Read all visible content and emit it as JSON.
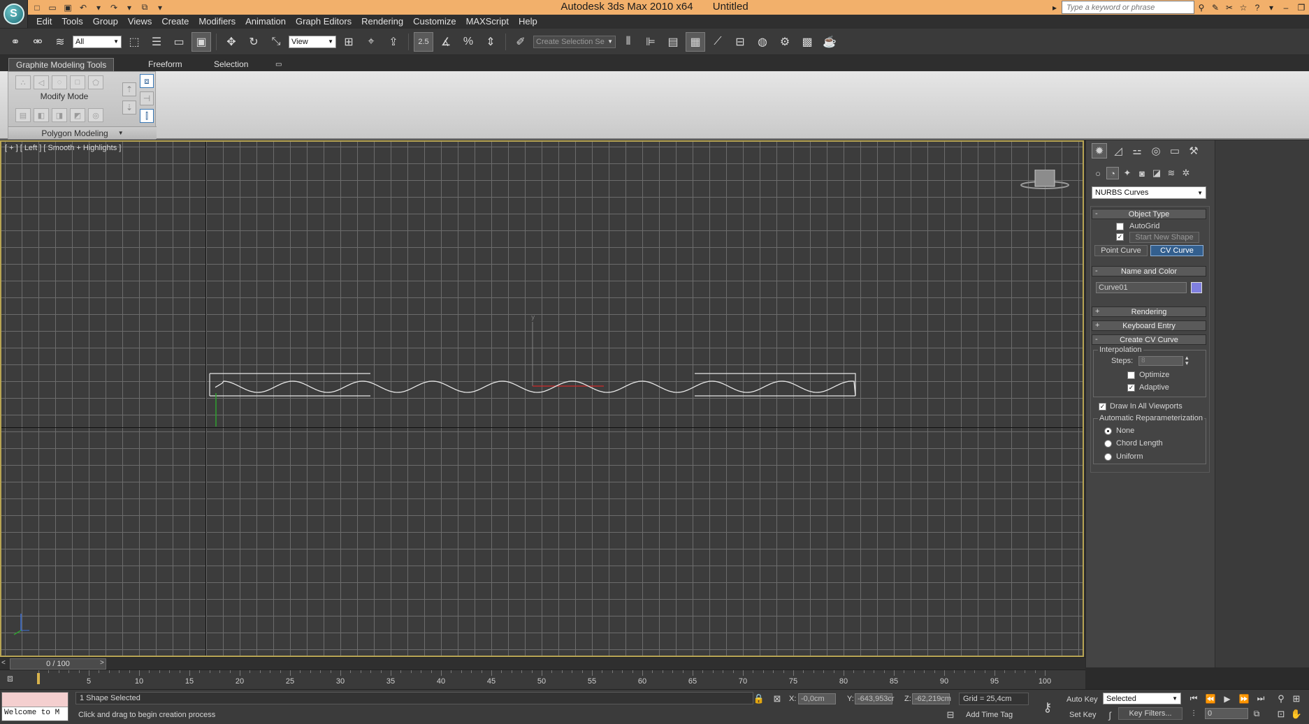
{
  "title": {
    "app_name": "Autodesk 3ds Max  2010 x64",
    "doc_name": "Untitled",
    "search_placeholder": "Type a keyword or phrase"
  },
  "menu": [
    "Edit",
    "Tools",
    "Group",
    "Views",
    "Create",
    "Modifiers",
    "Animation",
    "Graph Editors",
    "Rendering",
    "Customize",
    "MAXScript",
    "Help"
  ],
  "toolbar": {
    "selection_filter": "All",
    "ref_coord": "View",
    "snap_label": "2.5",
    "named_selection_placeholder": "Create Selection Se"
  },
  "ribbon": {
    "tabs": [
      "Graphite Modeling Tools",
      "Freeform",
      "Selection"
    ],
    "modify_mode": "Modify Mode",
    "polygon_modeling": "Polygon Modeling"
  },
  "viewport": {
    "label": "[ + ] [ Left ] [ Smooth + Highlights ]",
    "colors": {
      "border_active": "#b8a554",
      "grid": "#6c6c6c",
      "curve": "#e8e8e8",
      "x_axis": "#d02a2a",
      "y_axis": "#2fa02f"
    }
  },
  "command_panel": {
    "category": "NURBS Curves",
    "object_type": {
      "title": "Object Type",
      "autogrid": "AutoGrid",
      "autogrid_checked": false,
      "start_new_shape": "Start New Shape",
      "start_new_shape_checked": true,
      "point_curve": "Point Curve",
      "cv_curve": "CV Curve"
    },
    "name_and_color": {
      "title": "Name and Color",
      "name": "Curve01",
      "color": "#8080e0"
    },
    "rendering": {
      "title": "Rendering"
    },
    "keyboard_entry": {
      "title": "Keyboard Entry"
    },
    "create_cv_curve": {
      "title": "Create CV Curve",
      "interpolation": "Interpolation",
      "steps_label": "Steps:",
      "steps_value": "8",
      "optimize": "Optimize",
      "optimize_checked": false,
      "adaptive": "Adaptive",
      "adaptive_checked": true,
      "draw_all": "Draw In All Viewports",
      "draw_all_checked": true,
      "auto_repar": "Automatic Reparameterization",
      "options": [
        "None",
        "Chord Length",
        "Uniform"
      ],
      "selected_option": "None"
    }
  },
  "timeline": {
    "slider_label": "0 / 100",
    "ticks": [
      5,
      10,
      15,
      20,
      25,
      30,
      35,
      40,
      45,
      50,
      55,
      60,
      65,
      70,
      75,
      80,
      85,
      90,
      95,
      100
    ]
  },
  "status": {
    "maxscript_text": "Welcome to M",
    "selection": "1 Shape Selected",
    "prompt": "Click and drag to begin creation process",
    "x_label": "X:",
    "x_value": "-0,0cm",
    "y_label": "Y:",
    "y_value": "-643,953cr",
    "z_label": "Z:",
    "z_value": "-62,219cm",
    "grid": "Grid = 25,4cm",
    "add_time_tag": "Add Time Tag",
    "auto_key": "Auto Key",
    "set_key": "Set Key",
    "key_mode": "Selected",
    "key_filters": "Key Filters...",
    "frame": "0"
  }
}
